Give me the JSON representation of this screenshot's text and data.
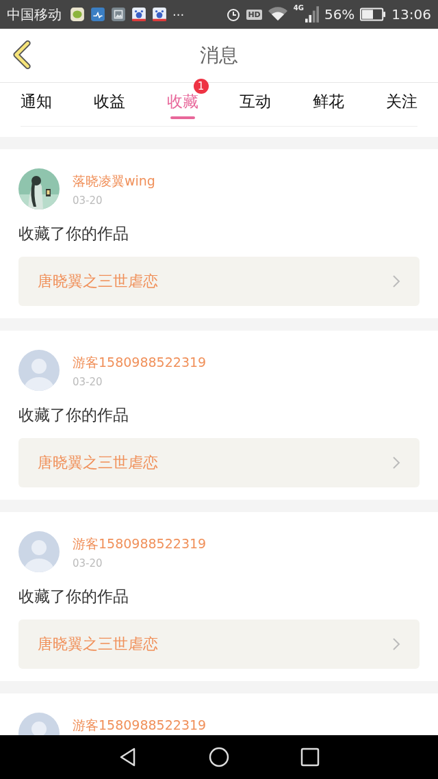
{
  "status_bar": {
    "carrier": "中国移动",
    "more": "···",
    "hd": "HD",
    "network": "4G",
    "battery": "56%",
    "time": "13:06"
  },
  "header": {
    "title": "消息"
  },
  "tabs": [
    {
      "label": "通知",
      "selected": false
    },
    {
      "label": "收益",
      "selected": false
    },
    {
      "label": "收藏",
      "selected": true,
      "badge": "1"
    },
    {
      "label": "互动",
      "selected": false
    },
    {
      "label": "鲜花",
      "selected": false
    },
    {
      "label": "关注",
      "selected": false
    }
  ],
  "messages": [
    {
      "name": "落晓凌翼wing",
      "date": "03-20",
      "text": "收藏了你的作品",
      "work": "唐晓翼之三世虐恋"
    },
    {
      "kind": "placeholder",
      "name": "游客1580988522319",
      "date": "03-20",
      "text": "收藏了你的作品",
      "work": "唐晓翼之三世虐恋"
    },
    {
      "kind": "placeholder",
      "name": "游客1580988522319",
      "date": "03-20",
      "text": "收藏了你的作品",
      "work": "唐晓翼之三世虐恋"
    },
    {
      "kind": "placeholder",
      "name": "游客1580988522319"
    }
  ]
}
